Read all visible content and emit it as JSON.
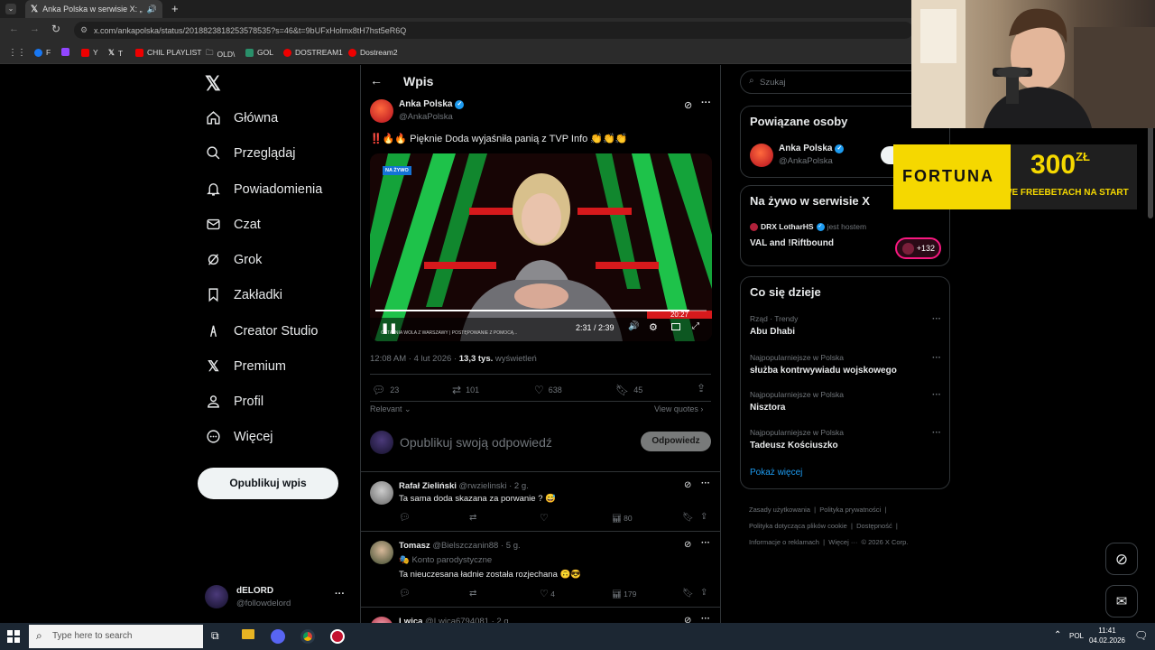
{
  "browser": {
    "tab_title": "Anka Polska w serwisie X: „",
    "url": "x.com/ankapolska/status/2018823818253578535?s=46&t=9bUFxHolmx8tH7hst5eR6Q",
    "bookmarks": [
      "F",
      "Y",
      "T",
      "CHIL PLAYLIST",
      "OLD\\",
      "GOL",
      "DOSTREAM1",
      "Dostream2"
    ]
  },
  "nav": {
    "items": [
      "Główna",
      "Przeglądaj",
      "Powiadomienia",
      "Czat",
      "Grok",
      "Zakładki",
      "Creator Studio",
      "Premium",
      "Profil",
      "Więcej"
    ],
    "post_button": "Opublikuj wpis",
    "account": {
      "name": "dELORD",
      "handle": "@followdelord"
    }
  },
  "post": {
    "header": "Wpis",
    "author_name": "Anka Polska",
    "author_handle": "@AnkaPolska",
    "text": "‼️🔥🔥 Pięknie Doda wyjaśniła panią z  TVP Info 👏👏👏",
    "video": {
      "live_badge": "NA ŻYWO",
      "time": "2:31 / 2:39",
      "clock": "20:27",
      "progress_fraction": 0.947,
      "ticker": "OSTATNIA WOLA Z WARSZAWY | POSTĘPOWANIE Z POMOCĄ..."
    },
    "timestamp": "12:08 AM · 4 lut 2026 · ",
    "views_count": "13,3 tys.",
    "views_label": " wyświetleń",
    "stats": {
      "replies": "23",
      "reposts": "101",
      "likes": "638",
      "bookmarks": "45"
    },
    "sort_label": "Relevant",
    "view_quotes": "View quotes",
    "reply_placeholder": "Opublikuj swoją odpowiedź",
    "reply_button": "Odpowiedz"
  },
  "replies": [
    {
      "name": "Rafał Zieliński",
      "handle": "@rwzielinski · 2 g.",
      "badge": "",
      "text": "Ta sama doda skazana za porwanie ? 😅",
      "likes": "",
      "views": "80"
    },
    {
      "name": "Tomasz",
      "handle": "@Bielszczanin88 · 5 g.",
      "badge": "🎭 Konto parodystyczne",
      "text": "Ta nieuczesana ładnie została rozjechana 🙃😎",
      "likes": "4",
      "views": "179"
    },
    {
      "name": "Lwica",
      "handle": "@Lwica6794081 · 2 g.",
      "badge": "",
      "text": "",
      "likes": "",
      "views": ""
    }
  ],
  "right": {
    "search_placeholder": "Szukaj",
    "related_title": "Powiązane osoby",
    "related_name": "Anka Polska",
    "related_handle": "@AnkaPolska",
    "live_title": "Na żywo w serwisie X",
    "live_host": "DRX LotharHS",
    "live_host_suffix": "jest hostem",
    "live_show": "VAL and !Riftbound",
    "live_count": "+132",
    "trends_title": "Co się dzieje",
    "trends": [
      {
        "context": "Rząd · Trendy",
        "topic": "Abu Dhabi"
      },
      {
        "context": "Najpopularniejsze w Polska",
        "topic": "służba kontrwywiadu wojskowego"
      },
      {
        "context": "Najpopularniejsze w Polska",
        "topic": "Nisztora"
      },
      {
        "context": "Najpopularniejsze w Polska",
        "topic": "Tadeusz Kościuszko"
      }
    ],
    "show_more": "Pokaż więcej",
    "footer": [
      "Zasady użytkowania",
      "Polityka prywatności",
      "Polityka dotycząca plików cookie",
      "Dostępność",
      "Informacje o reklamach",
      "Więcej ···",
      "© 2026 X Corp."
    ]
  },
  "ad": {
    "brand": "FORTUNA",
    "amount": "300",
    "currency": "ZŁ",
    "tagline": "WE FREEBETACH NA START"
  },
  "taskbar": {
    "search": "Type here to search",
    "lang": "POL",
    "time": "11:41",
    "date": "04.02.2026"
  },
  "colors": {
    "accent": "#1d9bf0",
    "background": "#000000",
    "border": "#2f3336",
    "muted": "#71767b",
    "ad_yellow": "#f5d800",
    "live_pink": "#f91880"
  }
}
